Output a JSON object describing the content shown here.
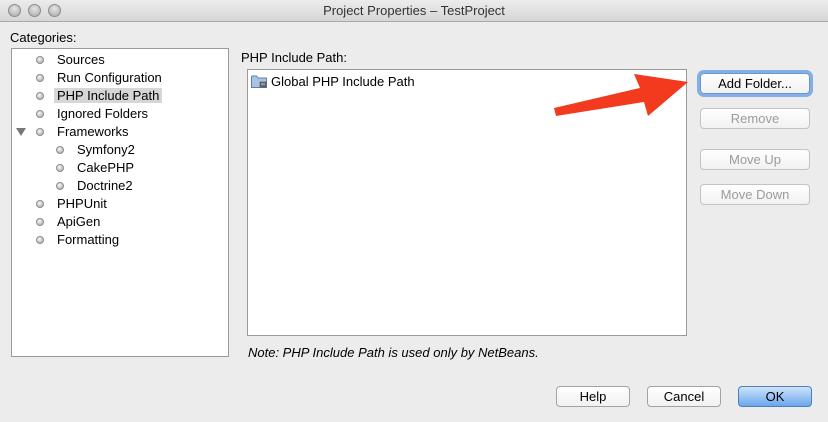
{
  "window": {
    "title": "Project Properties – TestProject"
  },
  "categories": {
    "label": "Categories:",
    "items": [
      {
        "label": "Sources"
      },
      {
        "label": "Run Configuration"
      },
      {
        "label": "PHP Include Path"
      },
      {
        "label": "Ignored Folders"
      },
      {
        "label": "Frameworks"
      },
      {
        "label": "Symfony2"
      },
      {
        "label": "CakePHP"
      },
      {
        "label": "Doctrine2"
      },
      {
        "label": "PHPUnit"
      },
      {
        "label": "ApiGen"
      },
      {
        "label": "Formatting"
      }
    ]
  },
  "include_path": {
    "label": "PHP Include Path:",
    "entries": [
      {
        "label": "Global PHP Include Path",
        "icon": "folder-icon"
      }
    ],
    "note": "Note: PHP Include Path is used only by NetBeans."
  },
  "actions": {
    "add_folder": "Add Folder...",
    "remove": "Remove",
    "move_up": "Move Up",
    "move_down": "Move Down"
  },
  "footer": {
    "help": "Help",
    "cancel": "Cancel",
    "ok": "OK"
  },
  "colors": {
    "arrow": "#f23a1e",
    "accent": "#6aa7ec"
  }
}
